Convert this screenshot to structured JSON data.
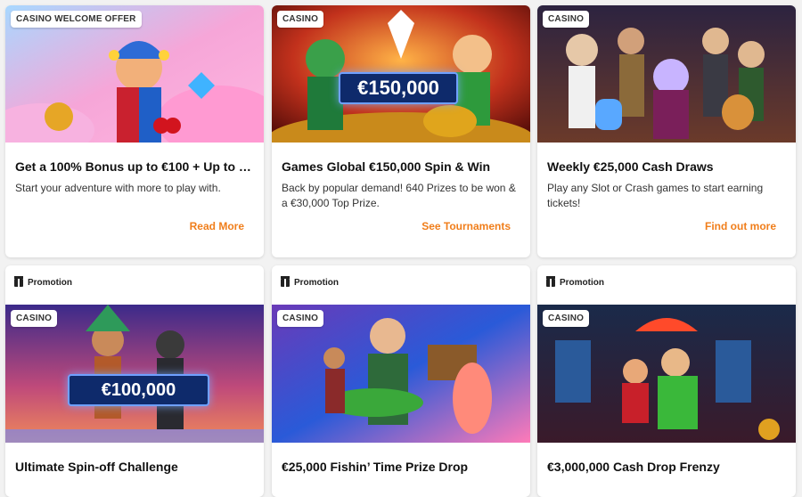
{
  "cards_top": [
    {
      "badge": "CASINO WELCOME OFFER",
      "title": "Get a 100% Bonus up to €100 + Up to 3...",
      "desc": "Start your adventure with more to play with.",
      "cta": "Read More"
    },
    {
      "badge": "CASINO",
      "prize": "€150,000",
      "title": "Games Global €150,000 Spin & Win",
      "desc": "Back by popular demand! 640 Prizes to be won & a €30,000 Top Prize.",
      "cta": "See Tournaments"
    },
    {
      "badge": "CASINO",
      "title": "Weekly €25,000 Cash Draws",
      "desc": "Play any Slot or Crash games to start earning tickets!",
      "cta": "Find out more"
    }
  ],
  "cards_bottom": [
    {
      "tag": "Promotion",
      "badge": "CASINO",
      "prize": "€100,000",
      "title": "Ultimate Spin-off Challenge"
    },
    {
      "tag": "Promotion",
      "badge": "CASINO",
      "title": "€25,000 Fishin’ Time Prize Drop"
    },
    {
      "tag": "Promotion",
      "badge": "CASINO",
      "title": "€3,000,000 Cash Drop Frenzy"
    }
  ],
  "colors": {
    "cta": "#f07e1b",
    "page_bg": "#f2f2f2"
  }
}
